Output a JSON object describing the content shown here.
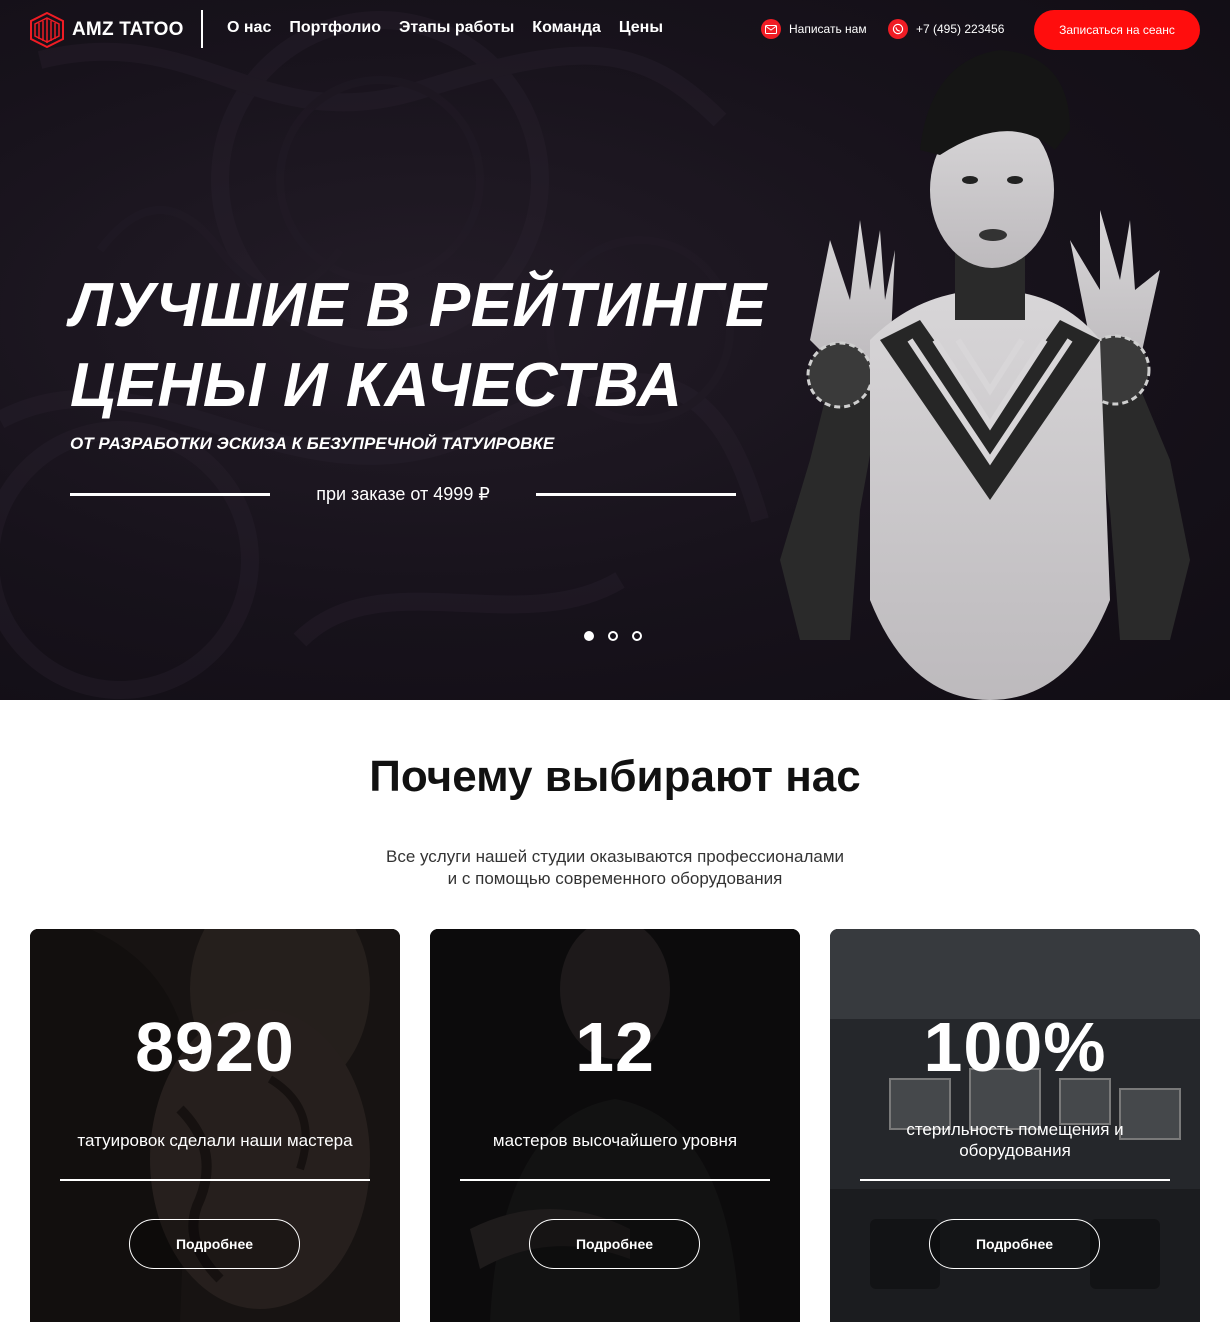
{
  "header": {
    "logo_text": "AMZ TATOO",
    "nav": [
      "О нас",
      "Портфолио",
      "Этапы работы",
      "Команда",
      "Цены"
    ],
    "write_label": "Написать нам",
    "phone": "+7 (495) 223456",
    "cta_label": "Записаться на сеанс"
  },
  "hero": {
    "title_line1": "ЛУЧШИЕ В РЕЙТИНГЕ",
    "title_line2": "ЦЕНЫ И КАЧЕСТВА",
    "subtitle": "ОТ РАЗРАБОТКИ ЭСКИЗА К БЕЗУПРЕЧНОЙ ТАТУИРОВКЕ",
    "price_text": "при заказе от 4999 ₽",
    "slides_count": 3,
    "active_slide": 1
  },
  "why": {
    "title": "Почему выбирают нас",
    "desc_line1": "Все услуги нашей студии оказываются профессионалами",
    "desc_line2": "и с помощью современного оборудования",
    "cards": [
      {
        "number": "8920",
        "text": "татуировок сделали наши мастера",
        "button": "Подробнее"
      },
      {
        "number": "12",
        "text": "мастеров высочайшего уровня",
        "button": "Подробнее"
      },
      {
        "number": "100%",
        "text": "стерильность помещения и оборудования",
        "button": "Подробнее"
      }
    ]
  },
  "colors": {
    "accent": "#ff0d0d",
    "hero_bg": "#17121b",
    "text_dark": "#111111"
  },
  "icons": {
    "logo": "cube-logo-icon",
    "write": "mail-icon",
    "phone": "whatsapp-icon"
  }
}
